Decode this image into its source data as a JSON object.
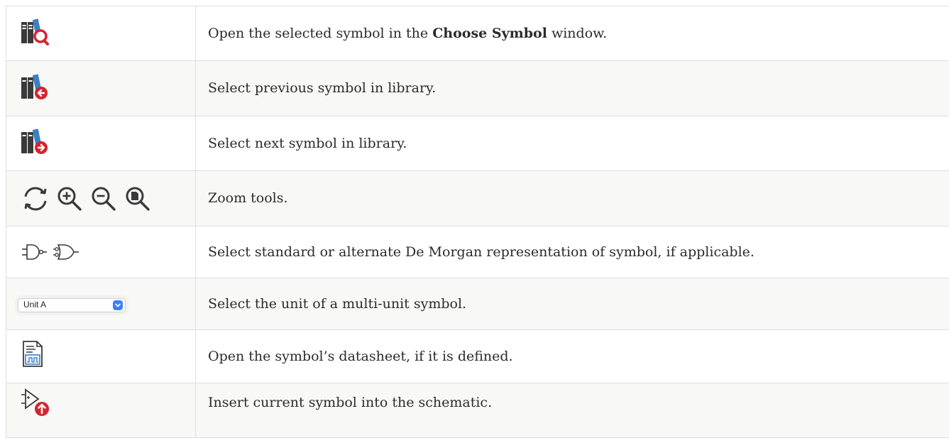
{
  "rows": [
    {
      "icon": "library-browse-icon",
      "text_before": "Open the selected symbol in the ",
      "bold": "Choose Symbol",
      "text_after": " window."
    },
    {
      "icon": "previous-symbol-icon",
      "text": "Select previous symbol in library."
    },
    {
      "icon": "next-symbol-icon",
      "text": "Select next symbol in library."
    },
    {
      "icons": [
        "refresh-icon",
        "zoom-in-icon",
        "zoom-out-icon",
        "zoom-fit-icon"
      ],
      "text": "Zoom tools."
    },
    {
      "icons": [
        "demorgan-standard-icon",
        "demorgan-alternate-icon"
      ],
      "text": "Select standard or alternate De Morgan representation of symbol, if applicable."
    },
    {
      "control": {
        "selected": "Unit A"
      },
      "text": "Select the unit of a multi-unit symbol."
    },
    {
      "icon": "datasheet-icon",
      "text": "Open the symbol’s datasheet, if it is defined."
    },
    {
      "icon": "insert-symbol-icon",
      "text": "Insert current symbol into the schematic."
    }
  ],
  "colors": {
    "accent_red": "#d6232f",
    "accent_blue": "#3b82f6",
    "icon_dark": "#3a3a3a",
    "border": "#dedede",
    "text": "#2b2b2b"
  }
}
